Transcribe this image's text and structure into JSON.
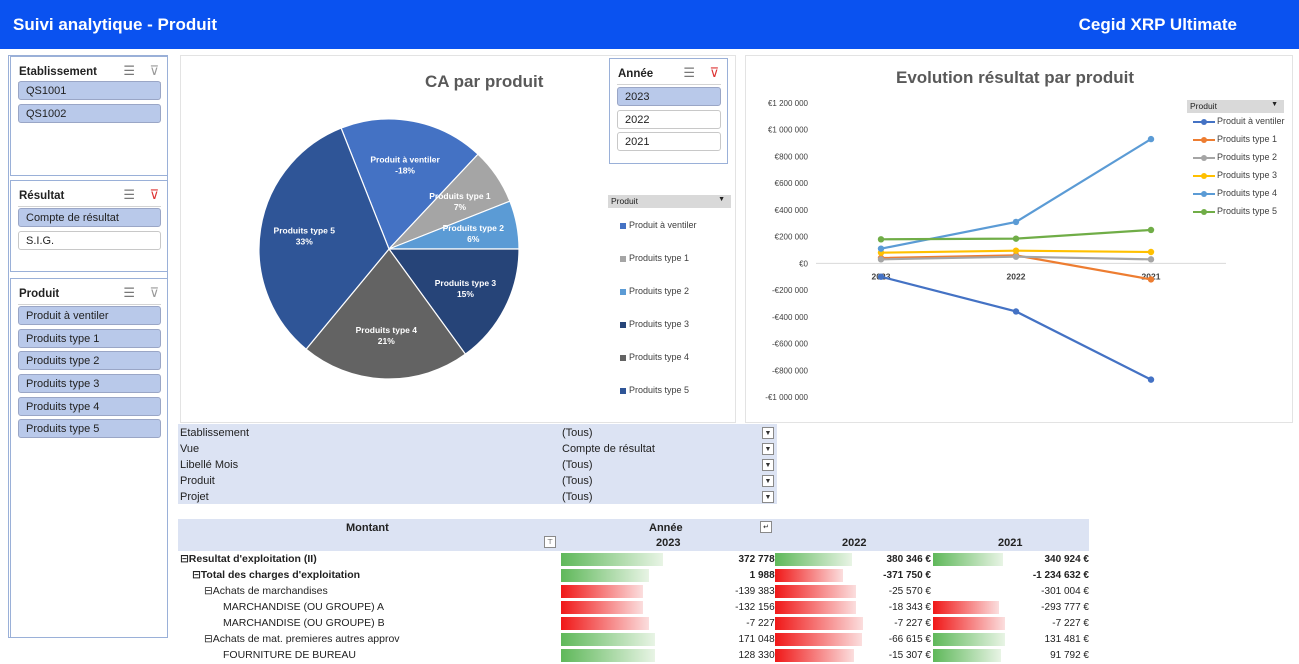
{
  "header": {
    "title": "Suivi analytique - Produit",
    "brand": "Cegid XRP Ultimate"
  },
  "slicers": {
    "etablissement": {
      "label": "Etablissement",
      "items": [
        {
          "label": "QS1001",
          "selected": true
        },
        {
          "label": "QS1002",
          "selected": true
        }
      ]
    },
    "resultat": {
      "label": "Résultat",
      "items": [
        {
          "label": "Compte de résultat",
          "selected": true
        },
        {
          "label": "S.I.G.",
          "selected": false
        }
      ]
    },
    "produit": {
      "label": "Produit",
      "items": [
        {
          "label": "Produit à ventiler"
        },
        {
          "label": "Produits type 1"
        },
        {
          "label": "Produits type 2"
        },
        {
          "label": "Produits type 3"
        },
        {
          "label": "Produits type 4"
        },
        {
          "label": "Produits type 5"
        }
      ]
    },
    "annee": {
      "label": "Année",
      "items": [
        {
          "label": "2023",
          "selected": true
        },
        {
          "label": "2022",
          "selected": false
        },
        {
          "label": "2021",
          "selected": false
        }
      ]
    }
  },
  "pie_chart": {
    "title": "CA par produit",
    "legend_header": "Produit",
    "slices": [
      {
        "label": "Produit à ventiler",
        "pct": "-18%",
        "value": 18,
        "color": "#4472c4"
      },
      {
        "label": "Produits type 1",
        "pct": "7%",
        "value": 7,
        "color": "#a5a5a5"
      },
      {
        "label": "Produits type 2",
        "pct": "6%",
        "value": 6,
        "color": "#5b9bd5"
      },
      {
        "label": "Produits type 3",
        "pct": "15%",
        "value": 15,
        "color": "#264478"
      },
      {
        "label": "Produits type 4",
        "pct": "21%",
        "value": 21,
        "color": "#636363"
      },
      {
        "label": "Produits type 5",
        "pct": "33%",
        "value": 33,
        "color": "#2f5597"
      }
    ],
    "legend": [
      "Produit à ventiler",
      "Produits type 1",
      "Produits type 2",
      "Produits type 3",
      "Produits type 4",
      "Produits type 5"
    ]
  },
  "chart_data": {
    "type": "line",
    "title": "Evolution résultat par produit",
    "categories": [
      "2023",
      "2022",
      "2021"
    ],
    "y_ticks": [
      "€1 200 000",
      "€1 000 000",
      "€800 000",
      "€600 000",
      "€400 000",
      "€200 000",
      "€0",
      "-€200 000",
      "-€400 000",
      "-€600 000",
      "-€800 000",
      "-€1 000 000"
    ],
    "ylim": [
      -1000000,
      1200000
    ],
    "legend_header": "Produit",
    "series": [
      {
        "name": "Produit à ventiler",
        "color": "#4472c4",
        "values": [
          -100000,
          -360000,
          -870000
        ]
      },
      {
        "name": "Produits type 1",
        "color": "#ed7d31",
        "values": [
          40000,
          60000,
          -120000
        ]
      },
      {
        "name": "Produits type 2",
        "color": "#a5a5a5",
        "values": [
          30000,
          50000,
          30000
        ]
      },
      {
        "name": "Produits type 3",
        "color": "#ffc000",
        "values": [
          80000,
          95000,
          85000
        ]
      },
      {
        "name": "Produits type 4",
        "color": "#5b9bd5",
        "values": [
          110000,
          310000,
          930000
        ]
      },
      {
        "name": "Produits type 5",
        "color": "#70ad47",
        "values": [
          180000,
          185000,
          250000
        ]
      }
    ]
  },
  "filters": [
    {
      "key": "Etablissement",
      "value": "(Tous)",
      "icon": "▼"
    },
    {
      "key": "Vue",
      "value": "Compte de résultat",
      "icon": "▼"
    },
    {
      "key": "Libellé Mois",
      "value": "(Tous)",
      "icon": "▼"
    },
    {
      "key": "Produit",
      "value": "(Tous)",
      "icon": "▼"
    },
    {
      "key": "Projet",
      "value": "(Tous)",
      "icon": "▼"
    }
  ],
  "pivot": {
    "col_label": "Montant",
    "row_label": "Année",
    "years": [
      "2023",
      "2022",
      "2021"
    ],
    "rows": [
      {
        "label": "⊟Resultat d'exploitation (II)",
        "indent": 0,
        "bold": true,
        "vals": [
          "372 778 €",
          "380 346 €",
          "340 924 €"
        ],
        "bars": [
          [
            1,
            0.49
          ],
          [
            1,
            0.5
          ],
          [
            1,
            0.45
          ]
        ]
      },
      {
        "label": "⊟Total des charges d'exploitation",
        "indent": 1,
        "bold": true,
        "vals": [
          "1 988 €",
          "-371 750 €",
          "-1 234 632 €"
        ],
        "bars": [
          [
            1,
            0.38
          ],
          [
            0,
            0.4
          ],
          [
            1,
            0.0
          ]
        ]
      },
      {
        "label": "⊟Achats de marchandises",
        "indent": 2,
        "bold": false,
        "vals": [
          "-139 383 €",
          "-25 570 €",
          "-301 004 €"
        ],
        "bars": [
          [
            0,
            0.33
          ],
          [
            0,
            0.55
          ],
          [
            0,
            0.0
          ]
        ]
      },
      {
        "label": "MARCHANDISE (OU GROUPE) A",
        "indent": 3,
        "bold": false,
        "vals": [
          "-132 156 €",
          "-18 343 €",
          "-293 777 €"
        ],
        "bars": [
          [
            0,
            0.33
          ],
          [
            0,
            0.55
          ],
          [
            0,
            0.4
          ]
        ]
      },
      {
        "label": "MARCHANDISE (OU GROUPE) B",
        "indent": 3,
        "bold": false,
        "vals": [
          "-7 227 €",
          "-7 227 €",
          "-7 227 €"
        ],
        "bars": [
          [
            0,
            0.38
          ],
          [
            0,
            0.63
          ],
          [
            0,
            0.47
          ]
        ]
      },
      {
        "label": "⊟Achats de mat. premieres  autres approv",
        "indent": 2,
        "bold": false,
        "vals": [
          "171 048 €",
          "-66 615 €",
          "131 481 €"
        ],
        "bars": [
          [
            1,
            0.43
          ],
          [
            0,
            0.62
          ],
          [
            1,
            0.47
          ]
        ]
      },
      {
        "label": "FOURNITURE DE BUREAU",
        "indent": 3,
        "bold": false,
        "vals": [
          "128 330 €",
          "-15 307 €",
          "91 792 €"
        ],
        "bars": [
          [
            1,
            0.43
          ],
          [
            0,
            0.53
          ],
          [
            1,
            0.42
          ]
        ]
      }
    ]
  }
}
